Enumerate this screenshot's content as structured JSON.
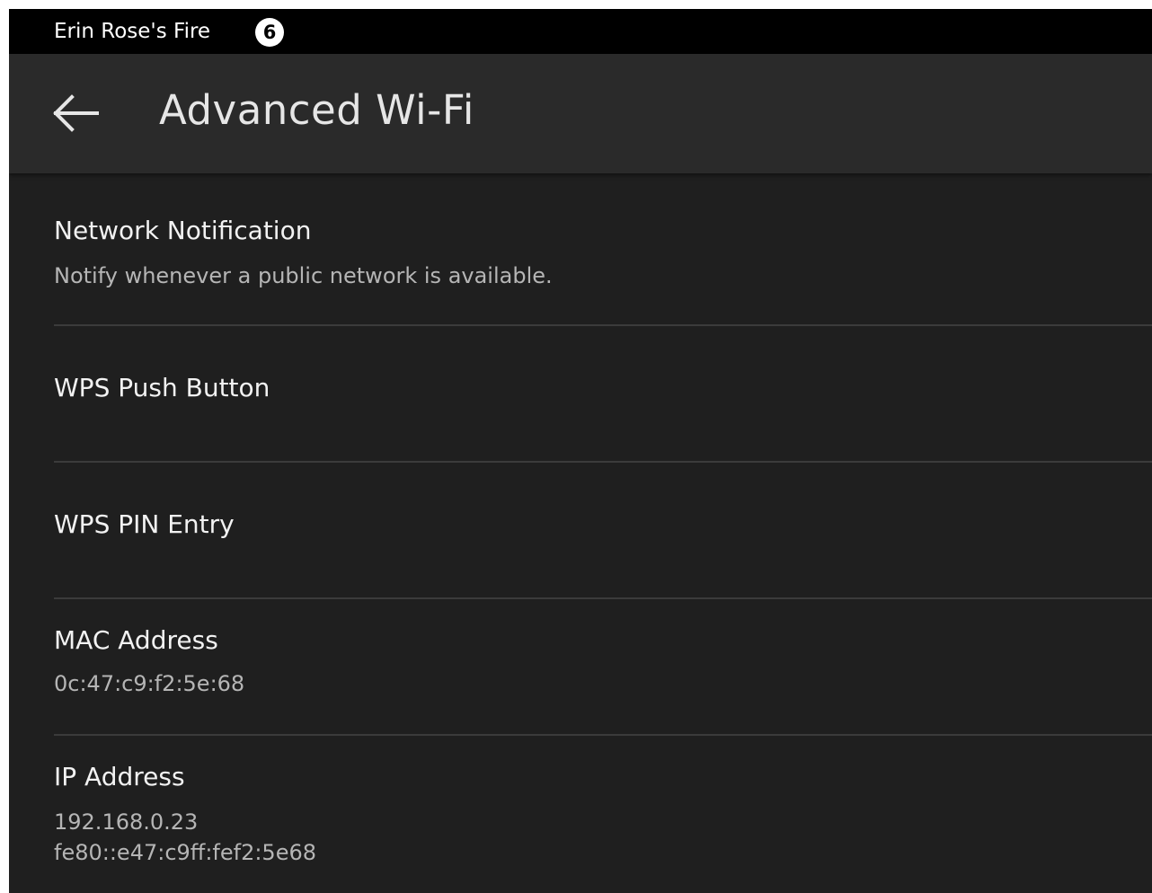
{
  "status_bar": {
    "device_name": "Erin Rose's Fire",
    "notification_count": "6"
  },
  "header": {
    "title": "Advanced Wi-Fi",
    "back_icon": "back-arrow-icon"
  },
  "settings": {
    "network_notification": {
      "title": "Network Notification",
      "subtitle": "Notify whenever a public network is available."
    },
    "wps_push_button": {
      "title": "WPS Push Button"
    },
    "wps_pin_entry": {
      "title": "WPS PIN Entry"
    },
    "mac_address": {
      "title": "MAC Address",
      "value": "0c:47:c9:f2:5e:68"
    },
    "ip_address": {
      "title": "IP Address",
      "ipv4": "192.168.0.23",
      "ipv6": "fe80::e47:c9ff:fef2:5e68"
    }
  },
  "colors": {
    "background": "#1f1f1f",
    "header_background": "#2a2a2a",
    "status_bar": "#000000",
    "divider": "#3b3b3b"
  }
}
